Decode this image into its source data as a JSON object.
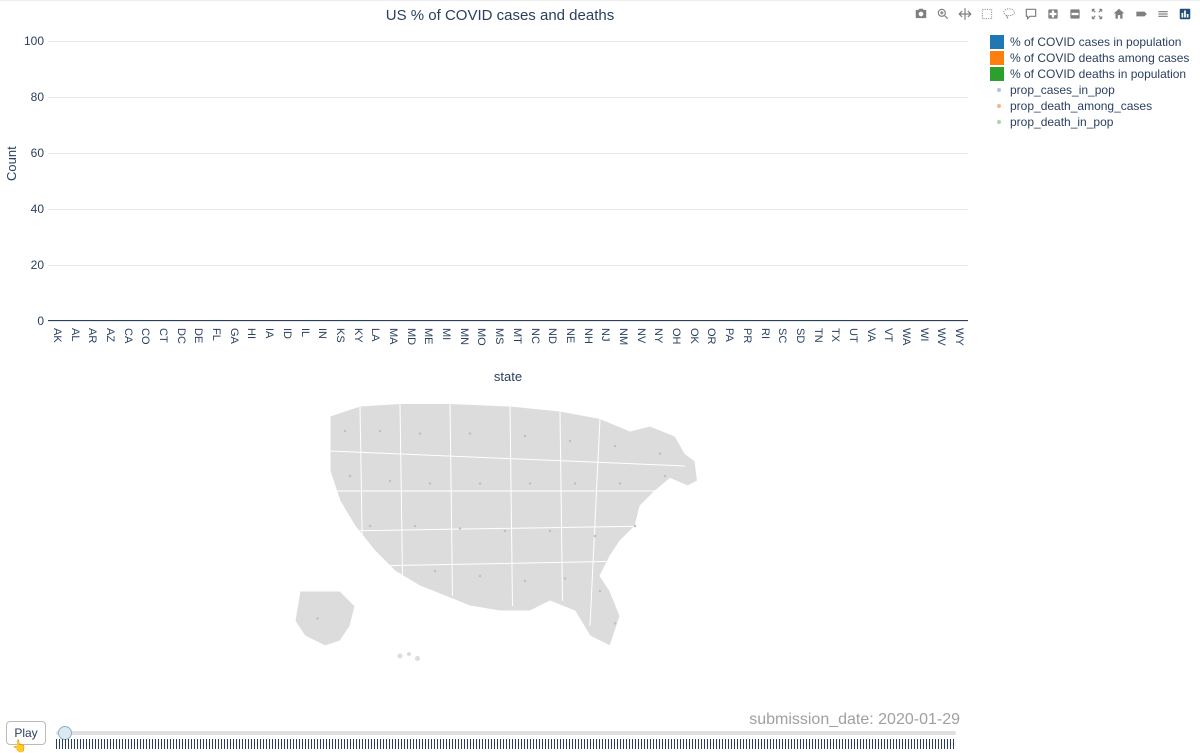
{
  "chart_data": {
    "type": "bar",
    "title": "US % of COVID cases and deaths",
    "xlabel": "state",
    "ylabel": "Count",
    "ylim": [
      0,
      100
    ],
    "yticks": [
      0,
      20,
      40,
      60,
      80,
      100
    ],
    "categories": [
      "AK",
      "AL",
      "AR",
      "AZ",
      "CA",
      "CO",
      "CT",
      "DC",
      "DE",
      "FL",
      "GA",
      "HI",
      "IA",
      "ID",
      "IL",
      "IN",
      "KS",
      "KY",
      "LA",
      "MA",
      "MD",
      "ME",
      "MI",
      "MN",
      "MO",
      "MS",
      "MT",
      "NC",
      "ND",
      "NE",
      "NH",
      "NJ",
      "NM",
      "NV",
      "NY",
      "OH",
      "OK",
      "OR",
      "PA",
      "PR",
      "RI",
      "SC",
      "SD",
      "TN",
      "TX",
      "UT",
      "VA",
      "VT",
      "WA",
      "WI",
      "WV",
      "WY"
    ],
    "series": [
      {
        "name": "% of COVID cases in population",
        "color": "#1f77b4",
        "values": [
          0,
          0,
          0,
          0,
          0,
          0,
          0,
          0,
          0,
          0,
          0,
          0,
          0,
          0,
          0,
          0,
          0,
          0,
          0,
          0,
          0,
          0,
          0,
          0,
          0,
          0,
          0,
          0,
          0,
          0,
          0,
          0,
          0,
          0,
          0,
          0,
          0,
          0,
          0,
          0,
          0,
          0,
          0,
          0,
          0,
          0,
          0,
          0,
          0,
          0,
          0,
          0
        ]
      },
      {
        "name": "% of COVID deaths among cases",
        "color": "#ff7f0e",
        "values": [
          0,
          0,
          0,
          0,
          0,
          0,
          0,
          0,
          0,
          0,
          0,
          0,
          0,
          0,
          0,
          0,
          0,
          0,
          0,
          0,
          0,
          0,
          0,
          0,
          0,
          0,
          0,
          0,
          0,
          0,
          0,
          0,
          0,
          0,
          0,
          0,
          0,
          0,
          0,
          0,
          0,
          0,
          0,
          0,
          0,
          0,
          0,
          0,
          0,
          0,
          0,
          0
        ]
      },
      {
        "name": "% of COVID deaths in population",
        "color": "#2ca02c",
        "values": [
          0,
          0,
          0,
          0,
          0,
          0,
          0,
          0,
          0,
          0,
          0,
          0,
          0,
          0,
          0,
          0,
          0,
          0,
          0,
          0,
          0,
          0,
          0,
          0,
          0,
          0,
          0,
          0,
          0,
          0,
          0,
          0,
          0,
          0,
          0,
          0,
          0,
          0,
          0,
          0,
          0,
          0,
          0,
          0,
          0,
          0,
          0,
          0,
          0,
          0,
          0,
          0
        ]
      }
    ],
    "marker_series": [
      {
        "name": "prop_cases_in_pop",
        "color": "#a6c8e4"
      },
      {
        "name": "prop_death_among_cases",
        "color": "#f5b787"
      },
      {
        "name": "prop_death_in_pop",
        "color": "#a6d8a6"
      }
    ]
  },
  "submission": {
    "label_prefix": "submission_date: ",
    "value": "2020-01-29"
  },
  "controls": {
    "play_label": "Play"
  },
  "toolbar": {
    "icons": [
      "camera",
      "zoom",
      "pan",
      "box-select",
      "lasso",
      "comment",
      "zoom-in",
      "zoom-out",
      "autoscale",
      "home",
      "scroll",
      "toggle",
      "logo"
    ]
  }
}
